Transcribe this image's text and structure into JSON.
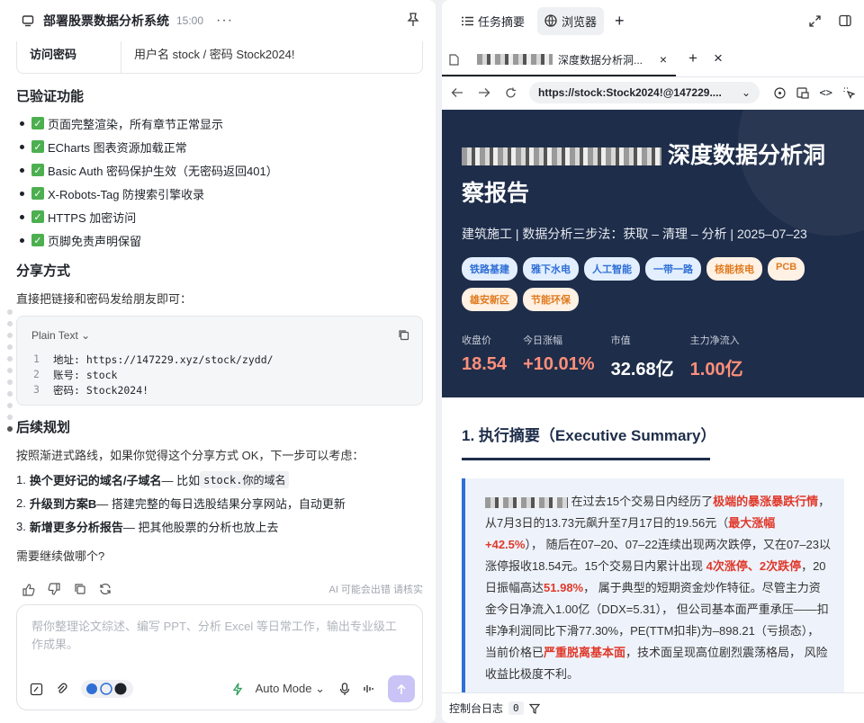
{
  "left": {
    "title": "部署股票数据分析系统",
    "time": "15:00",
    "table_row": {
      "key": "访问密码",
      "value": "用户名 stock / 密码 Stock2024!"
    },
    "verified": {
      "heading": "已验证功能",
      "items": [
        "页面完整渲染，所有章节正常显示",
        "ECharts 图表资源加载正常",
        "Basic Auth 密码保护生效（无密码返回401）",
        "X-Robots-Tag 防搜索引擎收录",
        "HTTPS 加密访问",
        "页脚免责声明保留"
      ]
    },
    "share": {
      "heading": "分享方式",
      "text": "直接把链接和密码发给朋友即可："
    },
    "code": {
      "lang": "Plain Text",
      "lines": [
        {
          "n": "1",
          "text": "地址: https://147229.xyz/stock/zydd/"
        },
        {
          "n": "2",
          "text": "账号: stock"
        },
        {
          "n": "3",
          "text": "密码: Stock2024!"
        }
      ]
    },
    "plan": {
      "heading": "后续规划",
      "intro": "按照渐进式路线，如果你觉得这个分享方式 OK，下一步可以考虑：",
      "items": [
        {
          "n": "1.",
          "bold": "换个更好记的域名/子域名",
          "rest": " — 比如 ",
          "code": "stock.你的域名"
        },
        {
          "n": "2.",
          "bold": "升级到方案B",
          "rest": " — 搭建完整的每日选股结果分享网站，自动更新",
          "code": ""
        },
        {
          "n": "3.",
          "bold": "新增更多分析报告",
          "rest": " — 把其他股票的分析也放上去",
          "code": ""
        }
      ],
      "question": "需要继续做哪个?"
    },
    "disclaimer": "AI 可能会出错 请核实",
    "input_placeholder": "帮你整理论文综述、编写 PPT、分析 Excel 等日常工作，输出专业级工作成果。",
    "mode": "Auto Mode"
  },
  "right": {
    "tabs": [
      "任务摘要",
      "浏览器"
    ],
    "browser_tab_title": "深度数据分析洞...",
    "url": "https://stock:Stock2024!@147229....",
    "hero": {
      "title": "深度数据分析洞察报告",
      "subtitle": "建筑施工 | 数据分析三步法：获取 – 清理 – 分析 | 2025–07–23",
      "tags_blue": [
        "铁路基建",
        "雅下水电",
        "人工智能",
        "一带一路"
      ],
      "tags_orange": [
        "核能核电",
        "PCB",
        "雄安新区",
        "节能环保"
      ],
      "stats": [
        {
          "label": "收盘价",
          "value": "18.54",
          "color": "#ff8f7a"
        },
        {
          "label": "今日涨幅",
          "value": "+10.01%",
          "color": "#ff8f7a"
        },
        {
          "label": "市值",
          "value": "32.68亿",
          "color": "#ffffff"
        },
        {
          "label": "主力净流入",
          "value": "1.00亿",
          "color": "#ff8f7a"
        }
      ]
    },
    "section_heading": "1. 执行摘要（Executive Summary）",
    "summary": {
      "p1": "在过去15个交易日内经历了",
      "r1": "极端的暴涨暴跌行情",
      "p2": "， 从7月3日的13.73元飙升至7月17日的19.56元（",
      "r2": "最大涨幅+42.5%",
      "p3": "）， 随后在07–20、07–22连续出现两次跌停，又在07–23以涨停报收18.54元。15个交易日内累计出现 ",
      "r3": "4次涨停、2次跌停",
      "p4": "，20日振幅高达",
      "r4": "51.98%",
      "p5": "， 属于典型的短期资金炒作特征。尽管主力资金今日净流入1.00亿（DDX=5.31）， 但公司基本面严重承压——扣非净利润同比下滑77.30%，PE(TTM扣非)为–898.21（亏损态）， 当前价格已",
      "r5": "严重脱离基本面",
      "p6": "，技术面呈现高位剧烈震荡格局， 风险收益比极度不利。"
    },
    "console_label": "控制台日志",
    "console_count": "0"
  },
  "colors": {
    "accent": "#2f6fd6",
    "hero_bg": "#1e2d4a",
    "alert_red": "#e0392b",
    "send": "#c9c3f6"
  }
}
